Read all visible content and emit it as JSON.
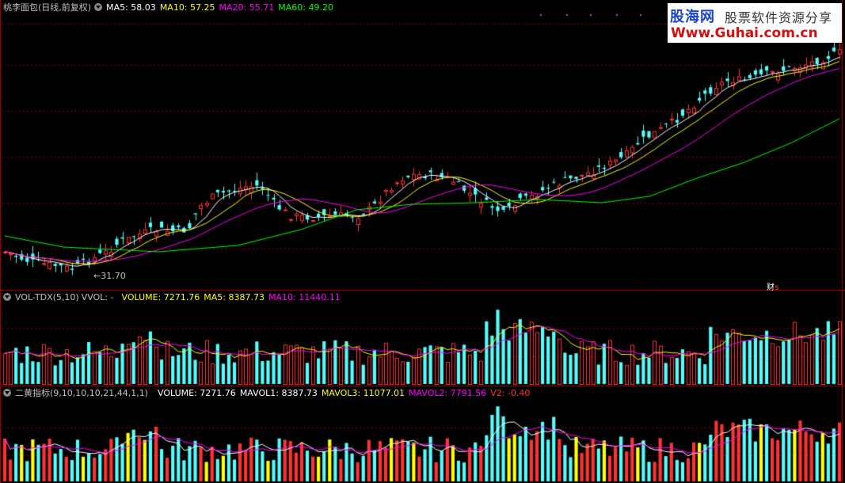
{
  "main_panel": {
    "stock_title": "桃李面包(日线,前复权)",
    "ma5": "MA5: 58.03",
    "ma10": "MA10: 57.25",
    "ma20": "MA20: 55.71",
    "ma60": "MA60: 49.20",
    "low_label": "31.70",
    "cai_label": "财",
    "s_label": "s"
  },
  "vol_panel": {
    "name": "VOL-TDX(5,10)",
    "vvol": "VVOL: -",
    "volume": "VOLUME: 7271.76",
    "ma5": "MA5: 8387.73",
    "ma10": "MA10: 11440.11"
  },
  "ind_panel": {
    "name": "二黄指标(9,10,10,10,21,44,1,1)",
    "volume": "VOLUME: 7271.76",
    "mavol1": "MAVOL1: 8387.73",
    "mavol3": "MAVOL3: 11077.01",
    "mavol2": "MAVOL2: 7791.56",
    "v2": "V2: -0.40"
  },
  "watermark": {
    "line1a": "股海网",
    "line1b": "股票软件资源分享",
    "line2": "Www.Guhai.com.cn"
  },
  "colors": {
    "up": "#ff3232",
    "down": "#54fcfc",
    "ma5": "#ffffff",
    "ma10": "#ffff00",
    "ma20": "#ff00ff",
    "ma60": "#00ff00",
    "grid": "#800000",
    "yellow_bar": "#ffff00"
  },
  "chart_data": {
    "type": "candlestick",
    "bars": 150,
    "price_low": 31.7,
    "ma_values": {
      "MA5": 58.03,
      "MA10": 57.25,
      "MA20": 55.71,
      "MA60": 49.2
    },
    "volume_last": 7271.76,
    "vol_ma5": 8387.73,
    "vol_ma10": 11440.11,
    "mavol3": 11077.01,
    "mavol2": 7791.56,
    "v2": -0.4
  }
}
